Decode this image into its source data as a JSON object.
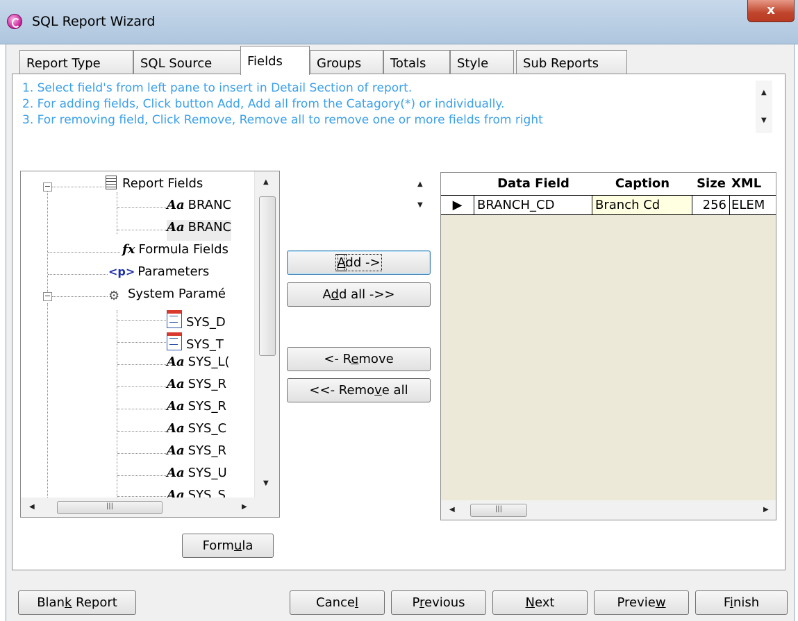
{
  "window": {
    "title": "SQL Report Wizard",
    "close_label": "x"
  },
  "tabs": [
    {
      "label": "Report Type"
    },
    {
      "label": "SQL Source"
    },
    {
      "label": "Fields"
    },
    {
      "label": "Groups"
    },
    {
      "label": "Totals"
    },
    {
      "label": "Style"
    },
    {
      "label": "Sub Reports"
    }
  ],
  "active_tab": "Fields",
  "instructions": [
    "1. Select field's from left pane to insert in Detail Section of report.",
    "2. For adding fields,  Click button Add, Add all from the Catagory(*) or individually.",
    "3. For removing field, Click Remove, Remove all to remove one or more fields from right"
  ],
  "tree": {
    "report_fields": "Report Fields",
    "report_field_items": [
      "BRANC",
      "BRANC"
    ],
    "formula_fields": "Formula Fields",
    "parameters": "Parameters",
    "system_params": "System Paramé",
    "system_items": [
      "SYS_D",
      "SYS_T",
      "SYS_L(",
      "SYS_R",
      "SYS_R",
      "SYS_C",
      "SYS_R",
      "SYS_U",
      "SYS_S"
    ],
    "icons": {
      "aa": "Aa",
      "fx": "fx",
      "p": "<p>"
    }
  },
  "middle_buttons": {
    "add": {
      "pre": "",
      "u": "A",
      "post": "dd ->"
    },
    "add_all": {
      "pre": "A",
      "u": "d",
      "post": "d all ->>"
    },
    "remove": {
      "pre": "<- R",
      "u": "e",
      "post": "move"
    },
    "remove_all": {
      "pre": "<<- Remo",
      "u": "v",
      "post": "e all"
    }
  },
  "formula_button": {
    "pre": "Form",
    "u": "u",
    "post": "la"
  },
  "grid": {
    "columns": [
      "Data Field",
      "Caption",
      "Size",
      "XML"
    ],
    "rows": [
      {
        "data_field": "BRANCH_CD",
        "caption": "Branch Cd",
        "size": "256",
        "xml": "ELEM"
      }
    ],
    "caption_bg": "#ffffe1"
  },
  "footer": {
    "blank_report": {
      "pre": "Blan",
      "u": "k",
      "post": " Report"
    },
    "cancel": {
      "pre": "Cance",
      "u": "l",
      "post": ""
    },
    "previous": {
      "pre": "P",
      "u": "r",
      "post": "evious"
    },
    "next": {
      "pre": "",
      "u": "N",
      "post": "ext"
    },
    "preview": {
      "pre": "Previe",
      "u": "w",
      "post": ""
    },
    "finish": {
      "pre": "F",
      "u": "i",
      "post": "nish"
    }
  },
  "colors": {
    "instruction_text": "#3ba0ea",
    "grid_background": "#ece9d8",
    "close_button": "#c0452c"
  }
}
